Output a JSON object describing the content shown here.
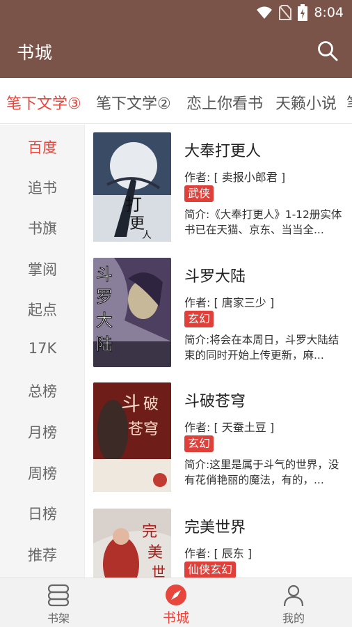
{
  "status_bar": {
    "time": "8:04"
  },
  "app_bar": {
    "title": "书城"
  },
  "source_tabs": [
    {
      "label": "笔下文学③",
      "active": true
    },
    {
      "label": "笔下文学②",
      "active": false
    },
    {
      "label": "恋上你看书",
      "active": false
    },
    {
      "label": "天籁小说",
      "active": false
    }
  ],
  "categories": [
    "百度",
    "追书",
    "书旗",
    "掌阅",
    "起点",
    "17K",
    "总榜",
    "月榜",
    "周榜",
    "日榜",
    "推荐"
  ],
  "books": [
    {
      "title": "大奉打更人",
      "author": "作者: [ 卖报小郎君 ]",
      "tag": "武侠",
      "intro": "简介:《大奉打更人》1-12册实体书已在天猫、京东、当当全..."
    },
    {
      "title": "斗罗大陆",
      "author": "作者: [ 唐家三少 ]",
      "tag": "玄幻",
      "intro": "简介:将会在本周日，斗罗大陆结束的同时开始上传更新，麻..."
    },
    {
      "title": "斗破苍穹",
      "author": "作者: [ 天蚕土豆 ]",
      "tag": "玄幻",
      "intro": "简介:这里是属于斗气的世界，没有花俏艳丽的魔法，有的，..."
    },
    {
      "title": "完美世界",
      "author": "作者: [ 辰东 ]",
      "tag": "仙侠玄幻",
      "intro": ""
    }
  ],
  "bottom_nav": [
    {
      "label": "书架",
      "icon": "bookshelf-icon"
    },
    {
      "label": "书城",
      "icon": "compass-icon",
      "active": true
    },
    {
      "label": "我的",
      "icon": "person-icon"
    }
  ],
  "colors": {
    "primary": "#7a5448",
    "accent": "#e8453c",
    "tag": "#e0403a"
  }
}
